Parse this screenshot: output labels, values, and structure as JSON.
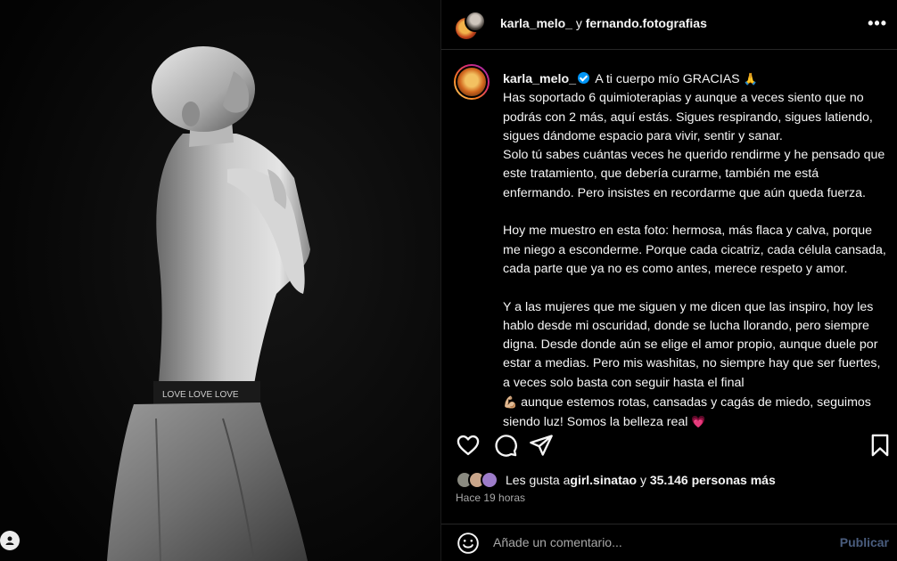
{
  "header": {
    "user1": "karla_melo_",
    "and_text": " y ",
    "user2": "fernando.fotografias",
    "more_icon": "more-horizontal-icon"
  },
  "caption": {
    "username": "karla_melo_",
    "title": "A ti cuerpo mío GRACIAS",
    "title_emoji": "🙏",
    "para1": "Has soportado 6 quimioterapias y aunque a veces siento que no podrás con 2 más, aquí estás. Sigues respirando, sigues latiendo, sigues dándome espacio para vivir, sentir y sanar.",
    "para2": "Solo tú sabes cuántas veces he querido rendirme y he pensado que este tratamiento, que debería curarme, también me está enfermando. Pero insistes en recordarme que aún queda fuerza.",
    "para3": "Hoy me muestro en esta foto: hermosa, más flaca y calva, porque me niego a esconderme. Porque cada cicatriz, cada célula cansada, cada parte que ya no es como antes, merece respeto y amor.",
    "para4a": "Y a las mujeres que me siguen y me dicen que las inspiro, hoy les hablo desde mi oscuridad, donde se lucha llorando, pero siempre digna. Desde donde aún se elige el amor propio, aunque duele por estar a medias. Pero mis washitas, no siempre hay que ser fuertes, a veces solo basta con seguir hasta el final",
    "para4_emoji1": "💪🏼",
    "para4b": " aunque estemos rotas, cansadas y cagás de miedo, seguimos siendo luz!  Somos la belleza real",
    "para4_emoji2": "💗"
  },
  "likes": {
    "prefix": "Les gusta a ",
    "user": "girl.sinatao",
    "middle": " y ",
    "count": "35.146 personas más"
  },
  "time": "Hace 19 horas",
  "comment": {
    "placeholder": "Añade un comentario...",
    "publish_label": "Publicar"
  },
  "colors": {
    "background": "#000000",
    "text": "#f5f5f5",
    "muted": "#a8a8a8",
    "verified": "#0095f6",
    "publish_disabled": "#4a5d7e"
  }
}
